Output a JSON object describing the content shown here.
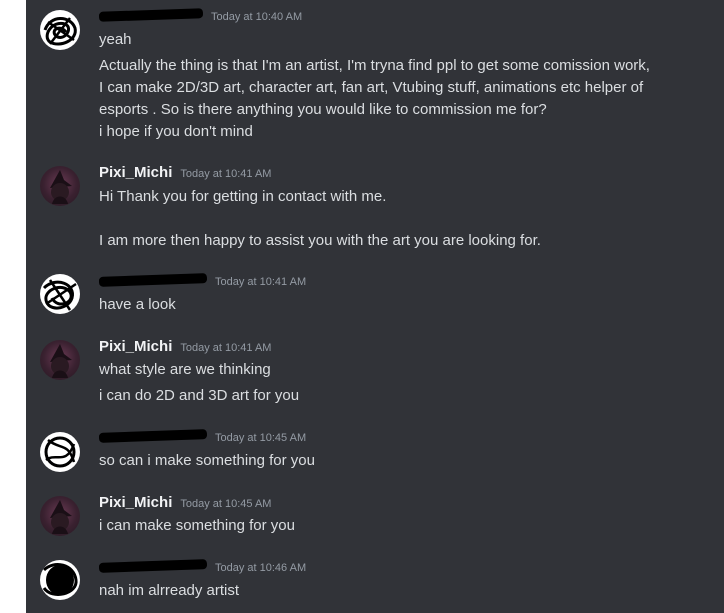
{
  "messages": [
    {
      "author": "",
      "author_redacted": true,
      "timestamp": "Today at 10:40 AM",
      "lines": [
        "yeah",
        "Actually the thing is that I'm an artist, I'm tryna find ppl to get some comission work,",
        "I can make 2D/3D art, character art, fan art, Vtubing stuff, animations etc helper of",
        "esports . So is there anything you would like to commission me for?",
        "i hope if you don't mind"
      ]
    },
    {
      "author": "Pixi_Michi",
      "timestamp": "Today at 10:41 AM",
      "lines": [
        "Hi Thank you for getting in contact with me.",
        "I am more then happy to assist you with the art you are looking for."
      ]
    },
    {
      "author": "",
      "author_redacted": true,
      "timestamp": "Today at 10:41 AM",
      "lines": [
        "have a look"
      ]
    },
    {
      "author": "Pixi_Michi",
      "timestamp": "Today at 10:41 AM",
      "lines": [
        "what style are we thinking",
        "i can do 2D and 3D art for you"
      ]
    },
    {
      "author": "",
      "author_redacted": true,
      "timestamp": "Today at 10:45 AM",
      "lines": [
        "so can i make something for you"
      ]
    },
    {
      "author": "Pixi_Michi",
      "timestamp": "Today at 10:45 AM",
      "lines": [
        "i can make something for you"
      ]
    },
    {
      "author": "",
      "author_redacted": true,
      "timestamp": "Today at 10:46 AM",
      "lines": [
        "nah im alrready artist"
      ]
    }
  ],
  "colors": {
    "background": "#313338",
    "username": "#f2f3f5",
    "text": "#dbdee1",
    "timestamp": "#949ba4"
  }
}
